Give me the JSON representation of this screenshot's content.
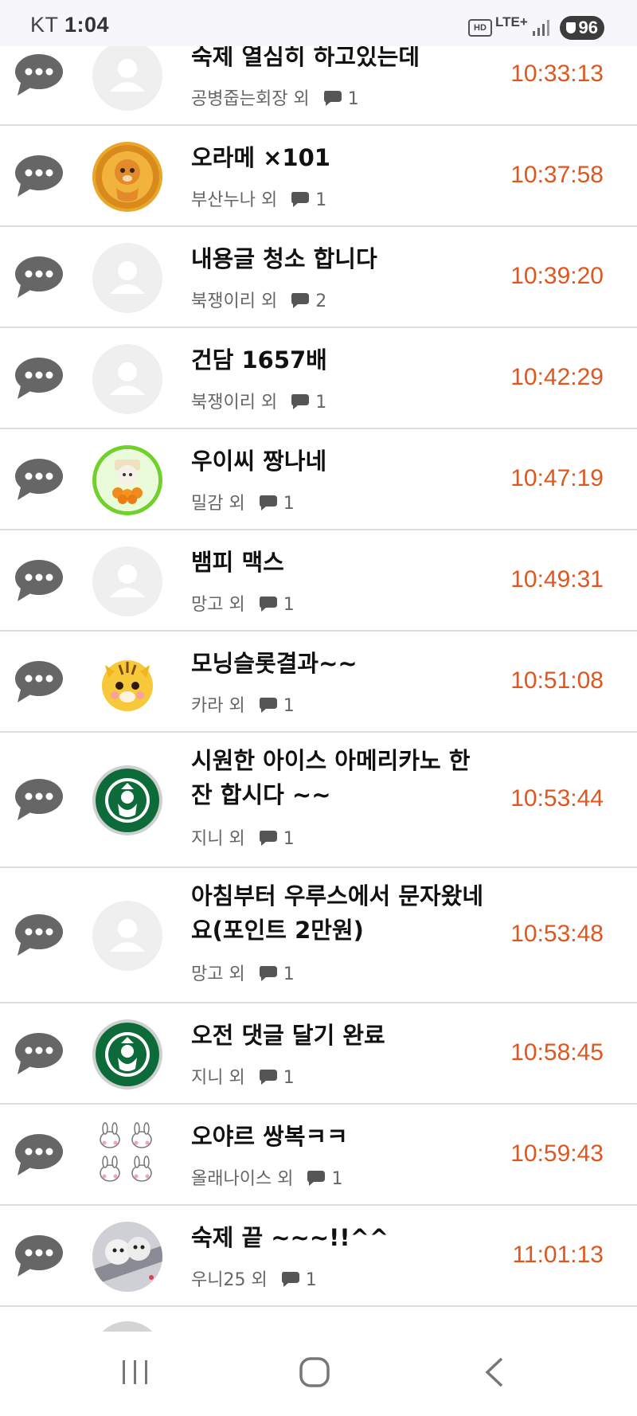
{
  "status_bar": {
    "carrier": "KT",
    "time": "1:04",
    "network": "LTE+",
    "battery": "96",
    "hd_label": "HD"
  },
  "posts": [
    {
      "title": "숙제 열심히 하고있는데",
      "author": "공병줍는회장 외",
      "comments": "1",
      "time": "10:33:13",
      "avatar": "default-avatar"
    },
    {
      "title": "오라메 ×101",
      "author": "부산누나 외",
      "comments": "1",
      "time": "10:37:58",
      "avatar": "lion-avatar"
    },
    {
      "title": "내용글 청소 합니다",
      "author": "북쟁이리 외",
      "comments": "2",
      "time": "10:39:20",
      "avatar": "default-avatar"
    },
    {
      "title": "건담 1657배",
      "author": "북쟁이리 외",
      "comments": "1",
      "time": "10:42:29",
      "avatar": "default-avatar"
    },
    {
      "title": "우이씨 짱나네",
      "author": "밀감 외",
      "comments": "1",
      "time": "10:47:19",
      "avatar": "tangerine-avatar"
    },
    {
      "title": "뱀피 맥스",
      "author": "망고 외",
      "comments": "1",
      "time": "10:49:31",
      "avatar": "default-avatar"
    },
    {
      "title": "모닝슬롯결과~~",
      "author": "카라 외",
      "comments": "1",
      "time": "10:51:08",
      "avatar": "tiger-avatar"
    },
    {
      "title": "시원한 아이스 아메리카노 한잔 합시다 ~~",
      "author": "지니 외",
      "comments": "1",
      "time": "10:53:44",
      "avatar": "starbucks-avatar"
    },
    {
      "title": "아침부터 우루스에서 문자왔네요(포인트 2만원)",
      "author": "망고 외",
      "comments": "1",
      "time": "10:53:48",
      "avatar": "default-avatar"
    },
    {
      "title": "오전 댓글 달기 완료",
      "author": "지니 외",
      "comments": "1",
      "time": "10:58:45",
      "avatar": "starbucks-avatar"
    },
    {
      "title": "오야르 쌍복ㅋㅋ",
      "author": "올래나이스 외",
      "comments": "1",
      "time": "10:59:43",
      "avatar": "bunnies-avatar"
    },
    {
      "title": "숙제 끝 ~~~!!^^",
      "author": "우니25 외",
      "comments": "1",
      "time": "11:01:13",
      "avatar": "puppies-avatar"
    }
  ],
  "nav": {
    "recents": "recent-apps-icon",
    "home": "home-icon",
    "back": "back-icon"
  }
}
